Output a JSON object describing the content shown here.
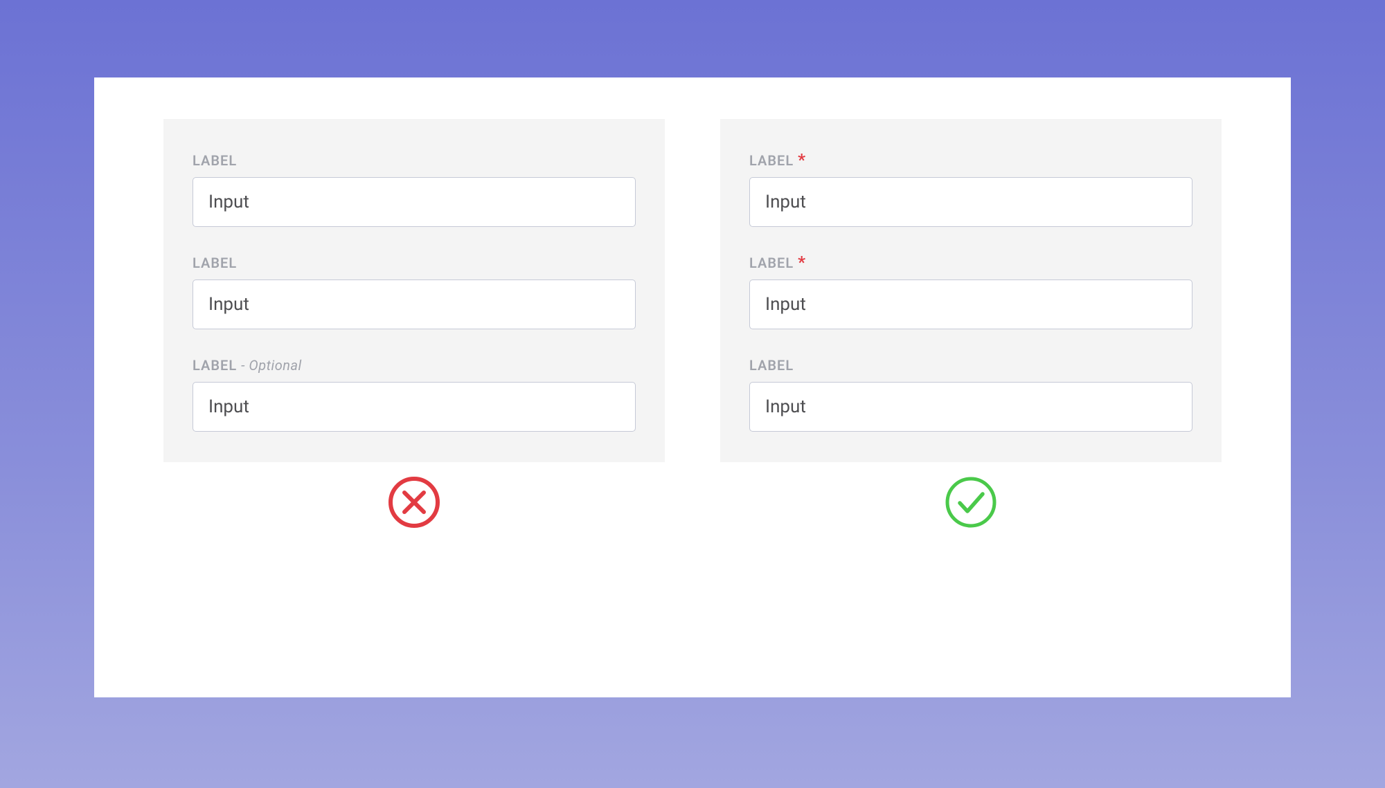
{
  "colors": {
    "error": "#e23b42",
    "success": "#4ac94a",
    "star": "#e23b42"
  },
  "left_panel": {
    "status": "error",
    "fields": [
      {
        "label": "LABEL",
        "suffix": "",
        "value": "Input"
      },
      {
        "label": "LABEL",
        "suffix": "",
        "value": "Input"
      },
      {
        "label": "LABEL",
        "suffix": "- Optional",
        "value": "Input"
      }
    ]
  },
  "right_panel": {
    "status": "success",
    "fields": [
      {
        "label": "LABEL",
        "required": true,
        "value": "Input"
      },
      {
        "label": "LABEL",
        "required": true,
        "value": "Input"
      },
      {
        "label": "LABEL",
        "required": false,
        "value": "Input"
      }
    ]
  }
}
